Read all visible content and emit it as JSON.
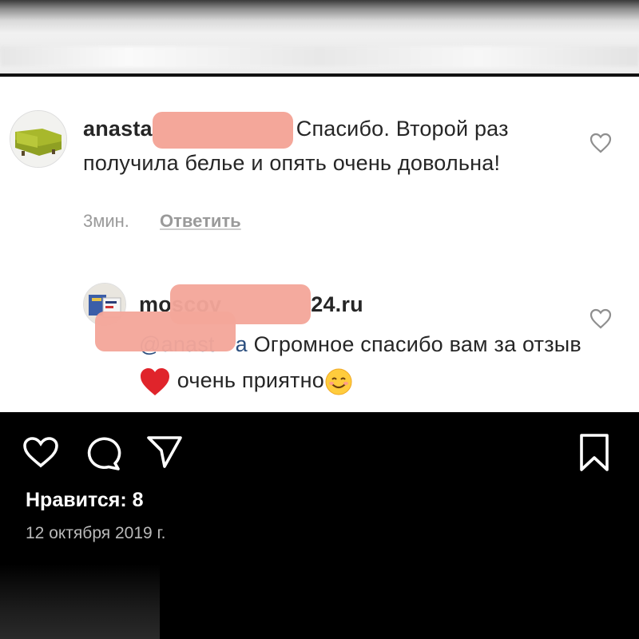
{
  "comment_1": {
    "username": "anasta",
    "text_line1": "Спасибо. Второй",
    "text_rest": "раз получила белье и опять очень довольна!",
    "time": "3мин.",
    "reply_label": "Ответить"
  },
  "comment_2": {
    "username_start": "moscov",
    "username_end": "24.ru",
    "mention_start": "@anast",
    "mention_end": "a",
    "text_1": "Огромное спасибо вам за отзыв",
    "text_2": "очень приятно"
  },
  "post": {
    "likes_label": "Нравится: 8",
    "date": "12 октября 2019 г."
  },
  "icons": {
    "like": "heart-icon",
    "comment": "comment-icon",
    "share": "send-icon",
    "save": "bookmark-icon",
    "emoji_heart": "red-heart-emoji",
    "emoji_smile": "smiling-face-emoji"
  },
  "colors": {
    "redaction": "#f4a79a",
    "mention": "#2b4e7e",
    "background_dark": "#000000"
  }
}
